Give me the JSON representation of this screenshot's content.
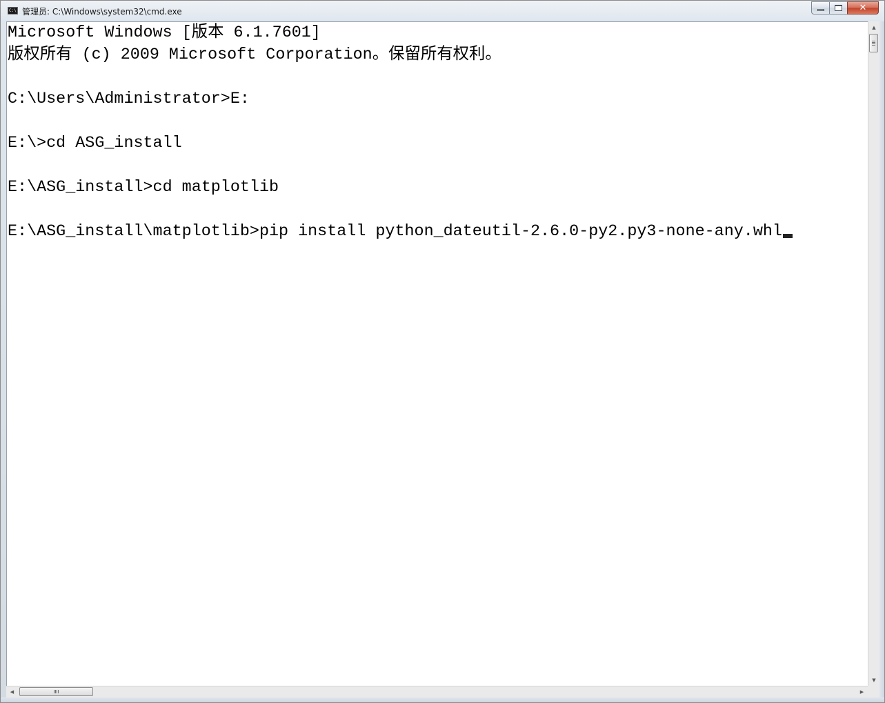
{
  "window": {
    "title": "管理员: C:\\Windows\\system32\\cmd.exe",
    "icon": "cmd-app-icon",
    "icon_text": "C:\\",
    "buttons": {
      "minimize_icon": "minimize-icon",
      "maximize_icon": "restore-icon",
      "close_label": "✕"
    }
  },
  "console": {
    "lines": [
      "Microsoft Windows [版本 6.1.7601]",
      "版权所有 (c) 2009 Microsoft Corporation。保留所有权利。",
      "",
      "C:\\Users\\Administrator>E:",
      "",
      "E:\\>cd ASG_install",
      "",
      "E:\\ASG_install>cd matplotlib",
      "",
      "E:\\ASG_install\\matplotlib>pip install python_dateutil-2.6.0-py2.py3-none-any.whl"
    ],
    "cursor_line_index": 9
  },
  "scrollbars": {
    "vertical": {
      "up_arrow": "▲",
      "down_arrow": "▼"
    },
    "horizontal": {
      "left_arrow": "◀",
      "right_arrow": "▶"
    }
  }
}
